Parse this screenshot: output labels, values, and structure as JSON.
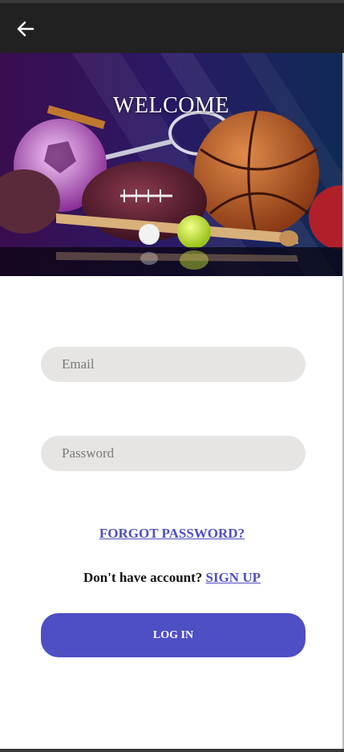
{
  "header": {
    "back_icon": "arrow-left-icon"
  },
  "hero": {
    "title": "WELCOME",
    "image": "sports-balls-banner"
  },
  "form": {
    "email_placeholder": "Email",
    "password_placeholder": "Password",
    "forgot_label": "FORGOT PASSWORD?",
    "signup_prompt": "Don't have account?",
    "signup_label": "SIGN UP",
    "login_label": "LOG IN"
  },
  "colors": {
    "topbar": "#212121",
    "accent": "#4e4ec5",
    "link": "#4f4fc4",
    "field_bg": "#e6e5e3"
  }
}
